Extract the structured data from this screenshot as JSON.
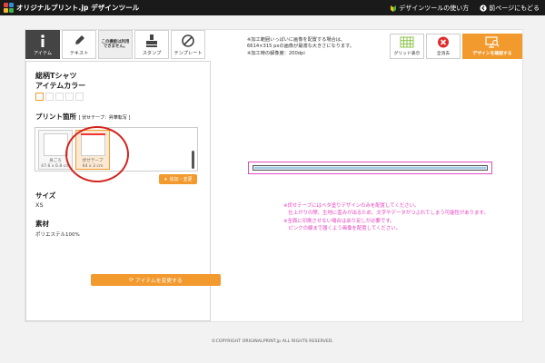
{
  "header": {
    "logo_text": "オリジナルプリント.jp デザインツール",
    "links": [
      {
        "label": "デザインツールの使い方",
        "icon": "beginner-icon"
      },
      {
        "label": "前ページにもどる",
        "icon": "back-arrow-icon"
      }
    ]
  },
  "tools": [
    {
      "label": "アイテム",
      "icon": "info-icon",
      "active": true
    },
    {
      "label": "テキスト",
      "icon": "pen-icon"
    },
    {
      "label": "この機能は利用できません。",
      "disabled": true
    },
    {
      "label": "スタンプ",
      "icon": "stamp-icon"
    },
    {
      "label": "テンプレート",
      "icon": "template-icon"
    }
  ],
  "item": {
    "title_line1": "総柄Tシャツ",
    "title_line2": "アイテムカラー",
    "print_label": "プリント箇所",
    "print_method": "[ 伏せテープ：昇華転写 ]",
    "print_cards": [
      {
        "name": "身ごろ",
        "size": "47.6 x 6.8 cm"
      },
      {
        "name": "伏せテープ",
        "size": "64 x 3 cm"
      }
    ],
    "add_button": "追加・変更",
    "size_label": "サイズ",
    "size_value": "XS",
    "material_label": "素材",
    "material_value": "ポリエステル100%",
    "change_button": "アイテムを変更する"
  },
  "note": {
    "line1": "※加工範囲いっぱいに画像を配置する場合は、",
    "line2": "6614×315 pxの画像が最適な大きさになります。",
    "line3": "※加工時の解像度：200dpi"
  },
  "right_buttons": {
    "grid": "グリッド表示",
    "clear": "全消去",
    "confirm": "デザインを確認する"
  },
  "warnings": [
    "※伏せテープにはベタ塗りデザインのみを配置してください。",
    "　仕上がりの際、生地に歪みが出るため、文字やデータがつぶれてしまう可能性があります。",
    "※全面に印刷させない場合は余り足しが必要です。",
    "　ピンクの線まで届くよう画像を配置してください。"
  ],
  "footer": "©COPYRIGHT ORIGINALPRINT.jp ALL RIGHTS RESERVED.",
  "colors": {
    "accent": "#f29a2e",
    "topbar": "#1a1a1a",
    "warning_text": "#e63fbf",
    "highlight_circle": "#d3241f"
  }
}
